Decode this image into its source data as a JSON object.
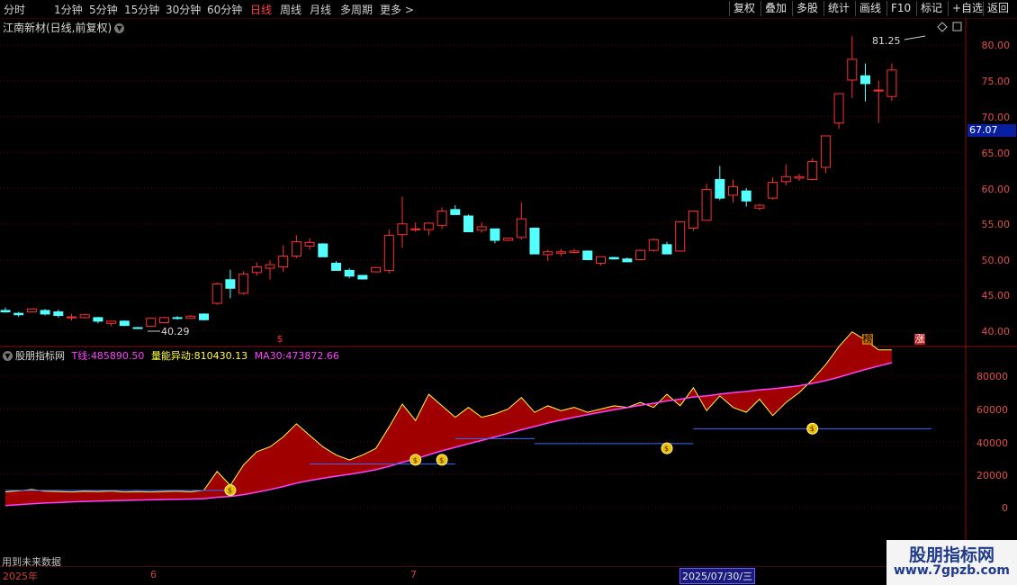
{
  "toolbar": {
    "periods": [
      "分时",
      "1分钟",
      "5分钟",
      "15分钟",
      "30分钟",
      "60分钟",
      "日线",
      "周线",
      "月线",
      "多周期",
      "更多 >"
    ],
    "active_period": "日线",
    "right_buttons": [
      "复权",
      "叠加",
      "多股",
      "统计",
      "画线",
      "F10",
      "标记",
      "+自选",
      "返回"
    ]
  },
  "stock": {
    "title": "江南新材(日线,前复权)",
    "current_price_tag": "67.07",
    "high_label": "81.25",
    "low_label": "40.29"
  },
  "price_axis": [
    "80.00",
    "75.00",
    "70.00",
    "65.00",
    "60.00",
    "55.00",
    "50.00",
    "45.00",
    "40.00"
  ],
  "indicator": {
    "name": "股朋指标网",
    "t_line_label": "T线:",
    "t_line_value": "485890.50",
    "energy_label": "量能异动:",
    "energy_value": "810430.13",
    "ma_label": "MA30:",
    "ma_value": "473872.66",
    "axis": [
      "80000",
      "60000",
      "40000",
      "20000",
      "0"
    ],
    "footer_note": "用到未来数据"
  },
  "dates": {
    "year": "2025年",
    "m6": "6",
    "m7": "7",
    "selected": "2025/07/30/三"
  },
  "badges": {
    "bang": "榜",
    "zhang": "涨",
    "dollar": "$"
  },
  "watermark": {
    "title": "股朋指标网",
    "url": "www.7gpzb.com"
  },
  "colors": {
    "up": "#ff3030",
    "down": "#54ffff",
    "fill": "#a00000",
    "ma": "#ff40ff",
    "ref": "#3a6cff"
  },
  "candles": [
    [
      42.9,
      43.3,
      42.6,
      42.7
    ],
    [
      42.5,
      42.7,
      42.0,
      42.3
    ],
    [
      42.7,
      43.2,
      42.6,
      43.1
    ],
    [
      42.9,
      43.1,
      42.2,
      42.4
    ],
    [
      42.7,
      43.0,
      41.9,
      42.2
    ],
    [
      41.9,
      42.4,
      41.5,
      42.0
    ],
    [
      41.9,
      42.4,
      41.8,
      42.3
    ],
    [
      41.9,
      42.0,
      41.1,
      41.4
    ],
    [
      41.1,
      41.4,
      40.7,
      41.4
    ],
    [
      41.4,
      41.5,
      40.7,
      40.8
    ],
    [
      40.5,
      40.6,
      40.3,
      40.4
    ],
    [
      40.7,
      41.9,
      40.6,
      41.8
    ],
    [
      41.2,
      42.0,
      41.1,
      41.9
    ],
    [
      41.9,
      42.1,
      41.6,
      41.8
    ],
    [
      41.8,
      42.3,
      41.7,
      42.1
    ],
    [
      42.4,
      42.5,
      41.5,
      41.6
    ],
    [
      43.9,
      46.8,
      43.7,
      46.6
    ],
    [
      47.2,
      48.6,
      44.6,
      46.0
    ],
    [
      45.3,
      48.4,
      45.1,
      48.0
    ],
    [
      48.2,
      49.6,
      47.8,
      49.0
    ],
    [
      48.8,
      49.9,
      47.2,
      49.3
    ],
    [
      49.0,
      52.0,
      48.3,
      50.5
    ],
    [
      50.5,
      53.4,
      50.2,
      52.5
    ],
    [
      51.9,
      53.0,
      51.4,
      52.4
    ],
    [
      52.2,
      52.3,
      50.4,
      50.4
    ],
    [
      49.5,
      49.8,
      48.8,
      48.5
    ],
    [
      48.5,
      48.8,
      47.4,
      47.7
    ],
    [
      47.8,
      47.8,
      47.2,
      47.3
    ],
    [
      48.3,
      49.0,
      48.2,
      48.9
    ],
    [
      48.5,
      54.2,
      48.1,
      53.4
    ],
    [
      53.5,
      58.8,
      51.7,
      55.0
    ],
    [
      54.3,
      55.2,
      53.9,
      54.3
    ],
    [
      54.2,
      55.2,
      53.4,
      55.1
    ],
    [
      54.8,
      57.3,
      54.3,
      56.8
    ],
    [
      57.0,
      57.6,
      56.3,
      56.3
    ],
    [
      56.1,
      56.3,
      53.9,
      53.9
    ],
    [
      54.1,
      55.2,
      53.8,
      54.6
    ],
    [
      54.3,
      54.3,
      52.3,
      52.7
    ],
    [
      52.7,
      53.0,
      52.6,
      53.0
    ],
    [
      53.1,
      58.0,
      52.8,
      55.7
    ],
    [
      54.4,
      54.5,
      50.8,
      50.8
    ],
    [
      50.7,
      51.4,
      49.8,
      51.1
    ],
    [
      50.9,
      51.5,
      50.5,
      51.1
    ],
    [
      51.0,
      51.5,
      50.9,
      51.2
    ],
    [
      51.2,
      51.3,
      50.0,
      50.0
    ],
    [
      49.5,
      50.4,
      49.2,
      50.4
    ],
    [
      50.3,
      50.4,
      50.0,
      50.1
    ],
    [
      50.1,
      50.3,
      49.7,
      49.7
    ],
    [
      50.0,
      51.4,
      50.0,
      51.3
    ],
    [
      51.3,
      53.0,
      51.1,
      52.8
    ],
    [
      52.1,
      52.5,
      50.8,
      50.8
    ],
    [
      51.2,
      55.4,
      51.1,
      55.3
    ],
    [
      54.4,
      55.8,
      54.0,
      56.8
    ],
    [
      55.5,
      60.6,
      55.5,
      59.8
    ],
    [
      61.2,
      63.1,
      58.3,
      58.6
    ],
    [
      59.0,
      61.2,
      58.0,
      60.2
    ],
    [
      59.6,
      60.0,
      57.4,
      58.2
    ],
    [
      57.2,
      57.8,
      56.9,
      57.6
    ],
    [
      58.6,
      61.5,
      58.4,
      60.8
    ],
    [
      60.9,
      63.3,
      60.4,
      61.6
    ],
    [
      61.4,
      62.0,
      61.0,
      61.6
    ],
    [
      61.2,
      64.2,
      61.1,
      63.7
    ],
    [
      62.9,
      66.8,
      62.1,
      67.3
    ],
    [
      69.1,
      72.3,
      68.3,
      73.2
    ],
    [
      75.1,
      81.2,
      72.6,
      78.0
    ],
    [
      75.7,
      77.4,
      72.1,
      74.6
    ],
    [
      73.6,
      75.0,
      69.1,
      73.7
    ],
    [
      72.8,
      77.4,
      72.2,
      76.5
    ]
  ],
  "volume_series": [
    9600,
    10200,
    11000,
    10000,
    9800,
    9500,
    9900,
    9700,
    10100,
    9500,
    9700,
    9500,
    9800,
    10000,
    9600,
    10500,
    22000,
    13500,
    26000,
    34000,
    37000,
    43000,
    51000,
    44000,
    37000,
    32000,
    29000,
    32000,
    36000,
    49000,
    63000,
    53000,
    69000,
    62000,
    55000,
    61000,
    55000,
    57000,
    60000,
    67000,
    58000,
    62000,
    59000,
    61000,
    58000,
    60000,
    62000,
    61000,
    64000,
    61000,
    69000,
    62000,
    73000,
    59000,
    68000,
    61000,
    58000,
    66000,
    56000,
    64000,
    70000,
    78000,
    87000,
    98000,
    107000,
    102000,
    96000,
    96000
  ],
  "ma_series": [
    1200,
    1800,
    2300,
    2800,
    3100,
    3500,
    3800,
    4000,
    4200,
    4400,
    4600,
    4700,
    4900,
    5100,
    5200,
    5400,
    6300,
    6800,
    7900,
    9400,
    11000,
    12800,
    14900,
    16500,
    17900,
    19100,
    20300,
    21600,
    23100,
    25100,
    27600,
    29600,
    32200,
    34600,
    36700,
    38900,
    40900,
    43000,
    45100,
    47400,
    49400,
    51500,
    53300,
    55000,
    56600,
    58100,
    59600,
    60900,
    62300,
    63500,
    64900,
    66000,
    67300,
    68000,
    69100,
    70000,
    70700,
    71700,
    72300,
    73200,
    74200,
    75600,
    77300,
    79400,
    81800,
    84100,
    86200,
    88200
  ]
}
